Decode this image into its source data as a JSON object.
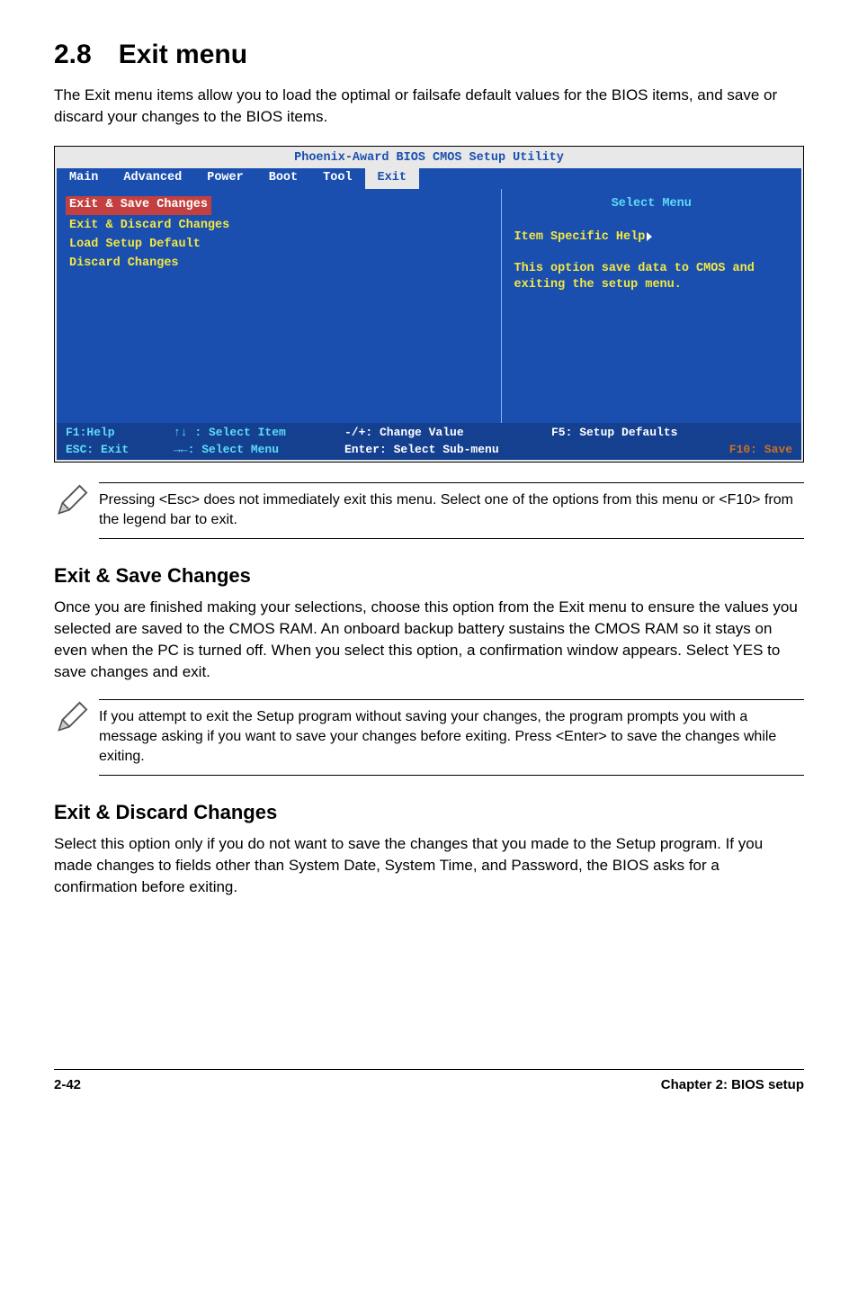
{
  "title": "2.8 Exit menu",
  "intro": "The Exit menu items allow you to load the optimal or failsafe default values for the BIOS items, and save or discard your changes to the BIOS items.",
  "bios": {
    "window_title": "Phoenix-Award BIOS CMOS Setup Utility",
    "tabs": [
      "Main",
      "Advanced",
      "Power",
      "Boot",
      "Tool",
      "Exit"
    ],
    "active_tab": "Exit",
    "items": {
      "selected": "Exit & Save Changes",
      "rest": [
        "Exit & Discard Changes",
        "Load Setup Default",
        "Discard Changes"
      ]
    },
    "right": {
      "title": "Select Menu",
      "help_line1": "Item Specific Help",
      "help_body": "This option save data to CMOS and exiting the setup menu."
    },
    "footer": {
      "col1a": "F1:Help",
      "col1b": "ESC: Exit",
      "col2a": "↑↓ : Select Item",
      "col2b": "→←: Select Menu",
      "col3a": "-/+: Change Value",
      "col3b": "Enter: Select Sub-menu",
      "col4a": "F5: Setup Defaults",
      "col4b": "F10: Save"
    }
  },
  "note1": "Pressing <Esc> does not immediately exit this menu. Select one of the options from this menu or <F10> from the legend bar to exit.",
  "section1": {
    "heading": "Exit & Save Changes",
    "body": "Once you are finished making your selections, choose this option from the Exit menu to ensure the values you selected are saved to the CMOS RAM. An onboard backup battery sustains the CMOS RAM so it stays on even when the PC is turned off. When you select this option, a confirmation window appears. Select YES to save changes and exit."
  },
  "note2": " If you attempt to exit the Setup program without saving your changes, the program prompts you with a message asking if you want to save your changes before exiting. Press <Enter>  to save the  changes while exiting.",
  "section2": {
    "heading": "Exit & Discard Changes",
    "body": "Select this option only if you do not want to save the changes that you made to the Setup program. If you made changes to fields other than System Date, System Time, and Password, the BIOS asks for a confirmation before exiting."
  },
  "footer": {
    "left": "2-42",
    "right": "Chapter 2: BIOS setup"
  }
}
